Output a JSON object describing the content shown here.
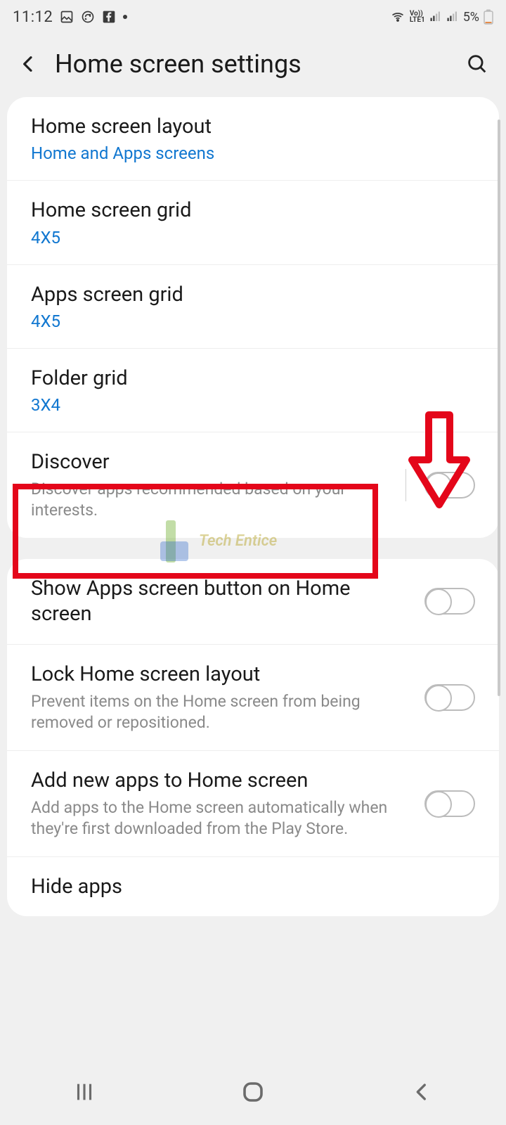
{
  "status": {
    "time": "11:12",
    "battery_pct": "5%"
  },
  "header": {
    "title": "Home screen settings"
  },
  "card1": {
    "items": [
      {
        "label": "Home screen layout",
        "sub": "Home and Apps screens"
      },
      {
        "label": "Home screen grid",
        "sub": "4X5"
      },
      {
        "label": "Apps screen grid",
        "sub": "4X5"
      },
      {
        "label": "Folder grid",
        "sub": "3X4"
      },
      {
        "label": "Discover",
        "desc": "Discover apps recommended based on your interests."
      }
    ]
  },
  "card2": {
    "items": [
      {
        "label": "Show Apps screen button on Home screen"
      },
      {
        "label": "Lock Home screen layout",
        "desc": "Prevent items on the Home screen from being removed or repositioned."
      },
      {
        "label": "Add new apps to Home screen",
        "desc": "Add apps to the Home screen automatically when they're first downloaded from the Play Store."
      },
      {
        "label": "Hide apps"
      }
    ]
  },
  "watermark": {
    "text": "Tech Entice"
  }
}
